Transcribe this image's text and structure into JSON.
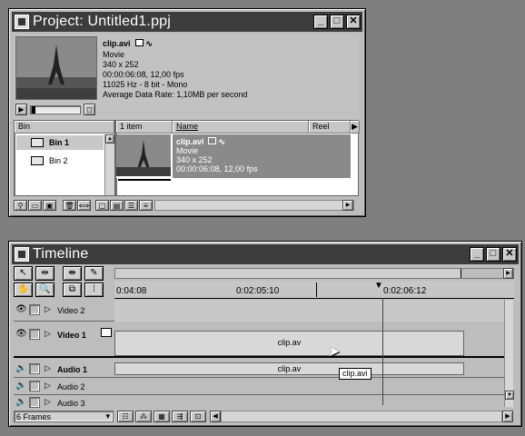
{
  "project": {
    "title": "Project: Untitled1.ppj",
    "clip_name": "clip.avi",
    "clip_type": "Movie",
    "clip_size": "340 x 252",
    "clip_duration": "00:00:06:08, 12,00 fps",
    "clip_audio": "11025 Hz - 8 bit - Mono",
    "clip_rate": "Average Data Rate: 1,10MB per second",
    "bin_header": "Bin",
    "bins": [
      "Bin 1",
      "Bin 2"
    ],
    "item_count": "1 item",
    "col_name": "Name",
    "col_reel": "Reel",
    "row_name": "clip.avi",
    "row_type": "Movie",
    "row_size": "340 x 252",
    "row_duration": "00:00:06:08, 12,00 fps"
  },
  "timeline": {
    "title": "Timeline",
    "ruler": [
      "0:04:08",
      "0:02:05:10",
      "0:02:06:12"
    ],
    "tracks": [
      {
        "name": "Video 2",
        "clip": ""
      },
      {
        "name": "Video 1",
        "clip": "clip.av"
      },
      {
        "name": "Audio 1",
        "clip": "clip.av"
      },
      {
        "name": "Audio 2",
        "clip": ""
      },
      {
        "name": "Audio 3",
        "clip": ""
      }
    ],
    "tooltip": "clip.avi",
    "zoom": "6 Frames"
  },
  "colors": {
    "titlebar": "#3c3c3c",
    "selection": "#888888",
    "desktop": "#7f7f7f"
  }
}
